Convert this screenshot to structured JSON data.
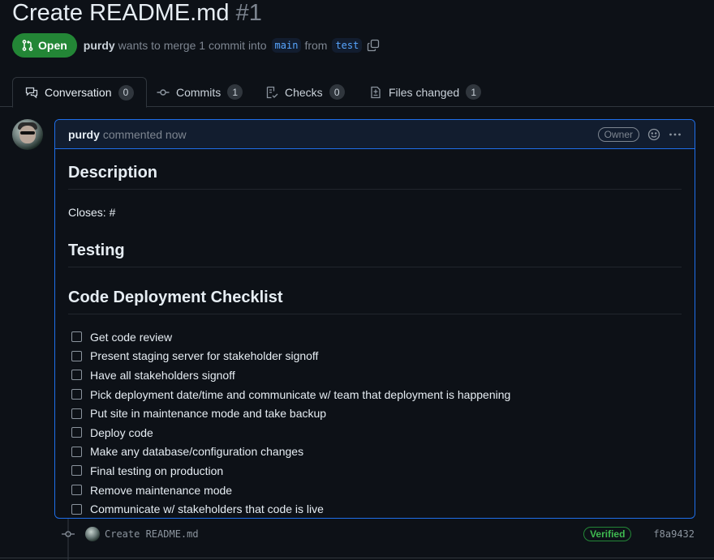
{
  "pr": {
    "title": "Create README.md",
    "number": "#1",
    "state": "Open",
    "author": "purdy",
    "merge_text": "wants to merge 1 commit into",
    "base_branch": "main",
    "from_text": "from",
    "head_branch": "test"
  },
  "tabs": [
    {
      "label": "Conversation",
      "count": "0",
      "icon": "comment-discussion-icon",
      "active": true
    },
    {
      "label": "Commits",
      "count": "1",
      "icon": "git-commit-icon"
    },
    {
      "label": "Checks",
      "count": "0",
      "icon": "checklist-icon"
    },
    {
      "label": "Files changed",
      "count": "1",
      "icon": "file-diff-icon"
    }
  ],
  "comment": {
    "author": "purdy",
    "meta": "commented now",
    "role_label": "Owner",
    "heading_description": "Description",
    "closes_text": "Closes: #",
    "heading_testing": "Testing",
    "heading_checklist": "Code Deployment Checklist",
    "checklist": [
      "Get code review",
      "Present staging server for stakeholder signoff",
      "Have all stakeholders signoff",
      "Pick deployment date/time and communicate w/ team that deployment is happening",
      "Put site in maintenance mode and take backup",
      "Deploy code",
      "Make any database/configuration changes",
      "Final testing on production",
      "Remove maintenance mode",
      "Communicate w/ stakeholders that code is live"
    ]
  },
  "commit": {
    "message": "Create README.md",
    "verified_label": "Verified",
    "sha": "f8a9432"
  },
  "colors": {
    "background": "#0d1117",
    "open_green": "#238636",
    "accent_blue": "#1f6feb",
    "muted_text": "#7d8590"
  }
}
